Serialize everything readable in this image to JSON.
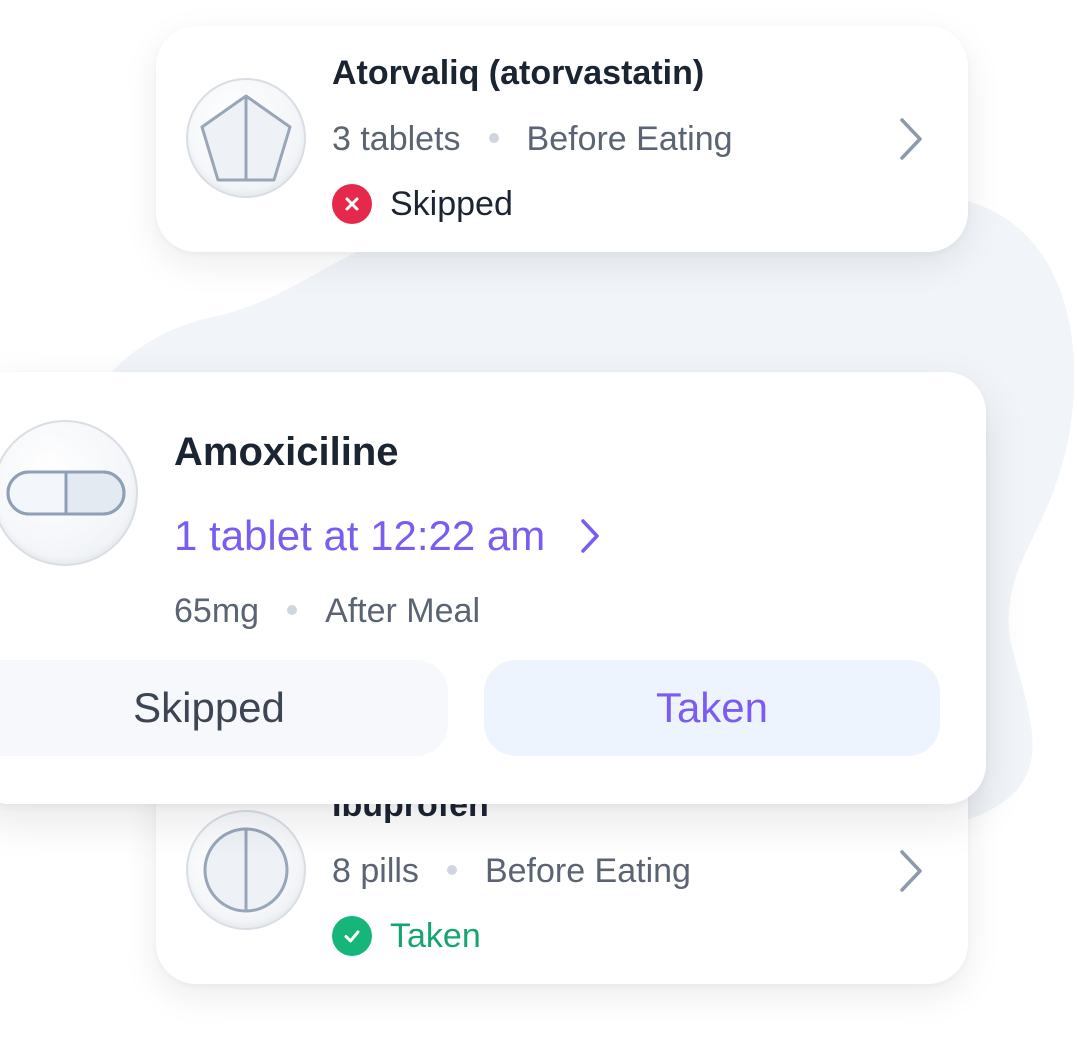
{
  "colors": {
    "accent": "#7b5cf0",
    "skipped": "#e5294b",
    "taken": "#16a571",
    "blob": "#f1f4f8"
  },
  "cards": {
    "top": {
      "name": "Atorvaliq (atorvastatin)",
      "quantity": "3 tablets",
      "timing": "Before Eating",
      "status": "Skipped",
      "status_icon": "x-circle-icon",
      "pill_icon": "pentagon-pill-icon"
    },
    "main": {
      "name": "Amoxiciline",
      "dose_time": "1 tablet at 12:22 am",
      "strength": "65mg",
      "timing": "After Meal",
      "pill_icon": "capsule-pill-icon",
      "skip_label": "Skipped",
      "taken_label": "Taken"
    },
    "bottom": {
      "name": "Ibuprofen",
      "quantity": "8 pills",
      "timing": "Before Eating",
      "status": "Taken",
      "status_icon": "check-circle-icon",
      "pill_icon": "round-pill-icon"
    }
  }
}
